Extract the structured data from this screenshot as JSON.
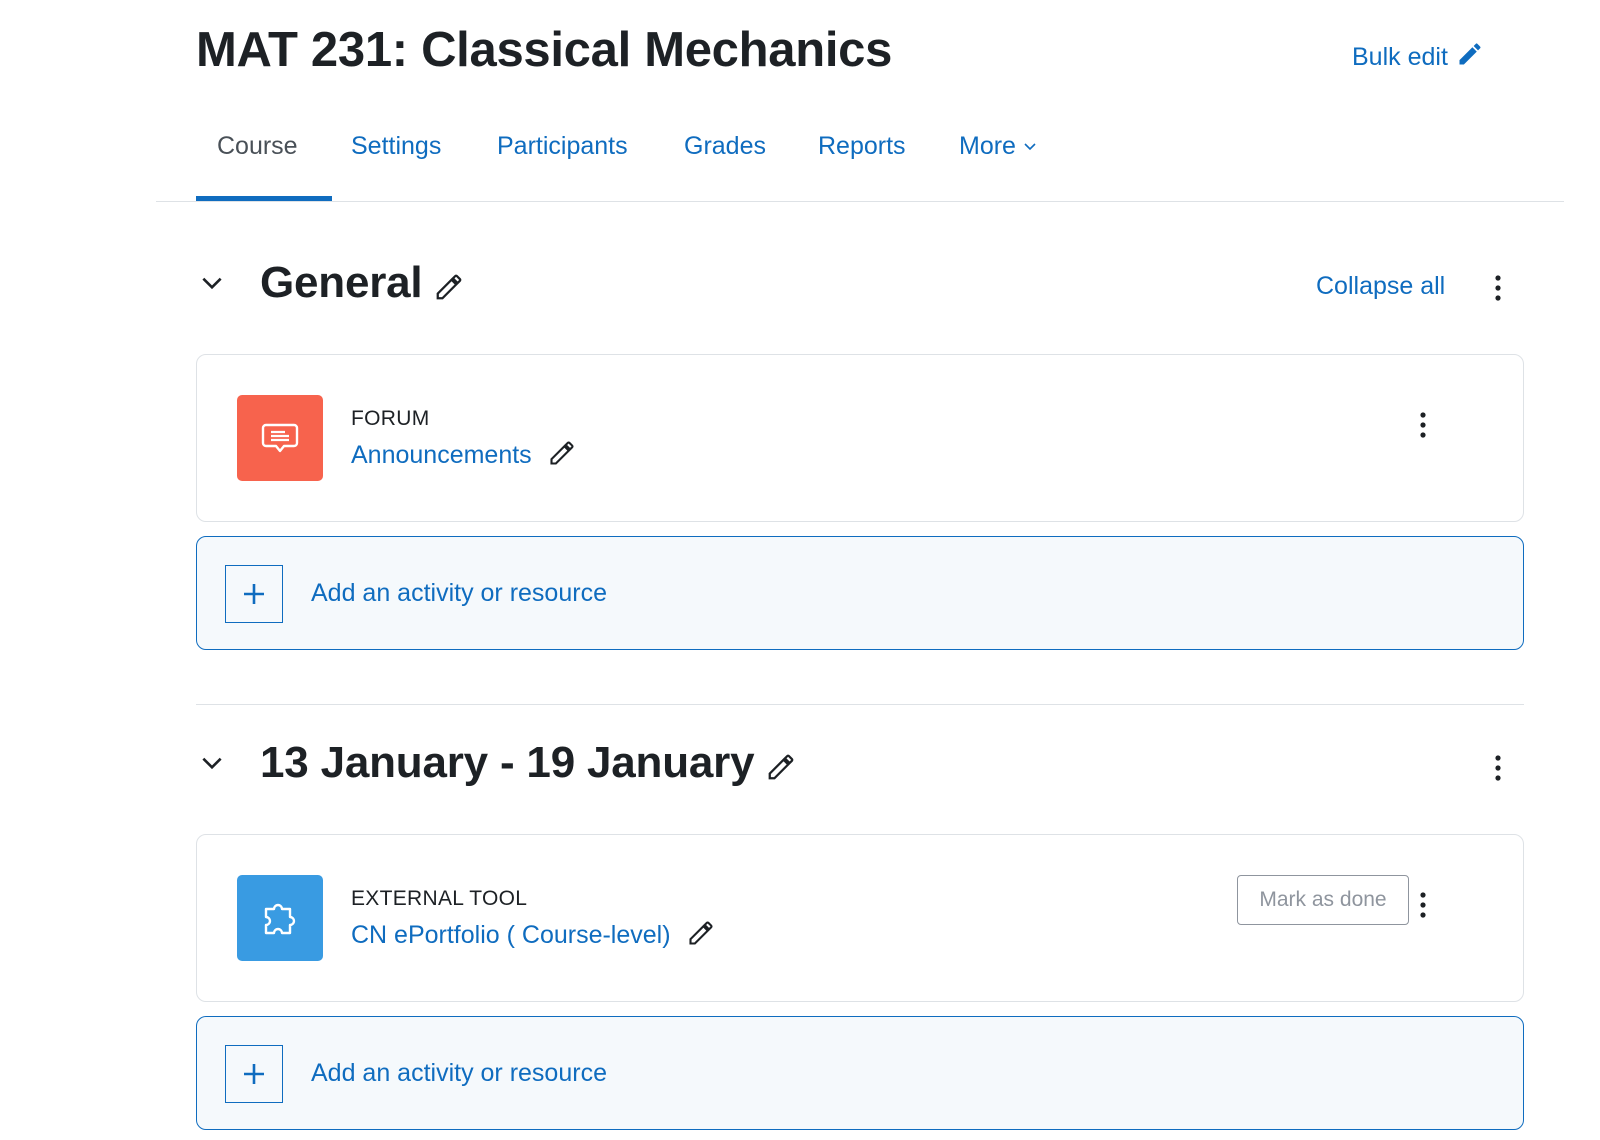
{
  "course": {
    "title": "MAT 231: Classical Mechanics",
    "bulk_edit_label": "Bulk edit"
  },
  "tabs": [
    {
      "label": "Course",
      "active": true
    },
    {
      "label": "Settings"
    },
    {
      "label": "Participants"
    },
    {
      "label": "Grades"
    },
    {
      "label": "Reports"
    },
    {
      "label": "More"
    }
  ],
  "collapse_all_label": "Collapse all",
  "sections": [
    {
      "title": "General",
      "activity": {
        "type": "FORUM",
        "name": "Announcements",
        "icon": "forum-icon",
        "icon_color": "#f7634d"
      },
      "add_label": "Add an activity or resource"
    },
    {
      "title": "13 January - 19 January",
      "activity": {
        "type": "EXTERNAL TOOL",
        "name": "CN ePortfolio ( Course-level)",
        "icon": "puzzle-icon",
        "icon_color": "#399be2",
        "completion_label": "Mark as done"
      },
      "add_label": "Add an activity or resource"
    }
  ],
  "colors": {
    "link": "#0f6cbf",
    "text": "#1d2125",
    "border": "#dee2e6"
  }
}
